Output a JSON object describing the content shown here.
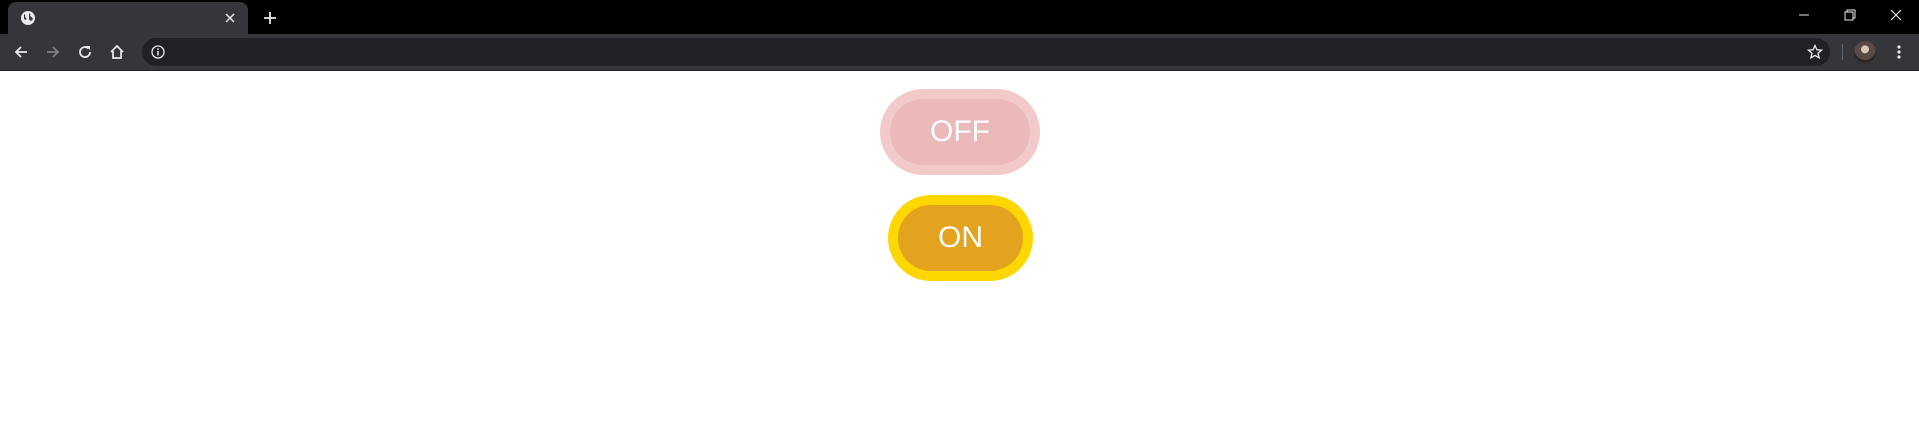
{
  "browser": {
    "tab": {
      "title": "",
      "favicon": "globe-icon",
      "close_icon": "close-icon"
    },
    "new_tab_icon": "plus-icon",
    "window_controls": [
      "minimize-icon",
      "restore-icon",
      "close-icon"
    ],
    "toolbar": {
      "back_icon": "arrow-left-icon",
      "forward_icon": "arrow-right-icon",
      "reload_icon": "reload-icon",
      "home_icon": "home-icon",
      "address": {
        "value": "",
        "info_icon": "info-icon",
        "star_icon": "star-icon"
      },
      "menu_icon": "kebab-menu-icon"
    }
  },
  "toggles": [
    {
      "label": "OFF",
      "state": false,
      "outer_color": "#f3c9c9",
      "inner_color": "#ebb9b9"
    },
    {
      "label": "ON",
      "state": true,
      "outer_color": "#fed700",
      "inner_color": "#e3a31f"
    }
  ]
}
